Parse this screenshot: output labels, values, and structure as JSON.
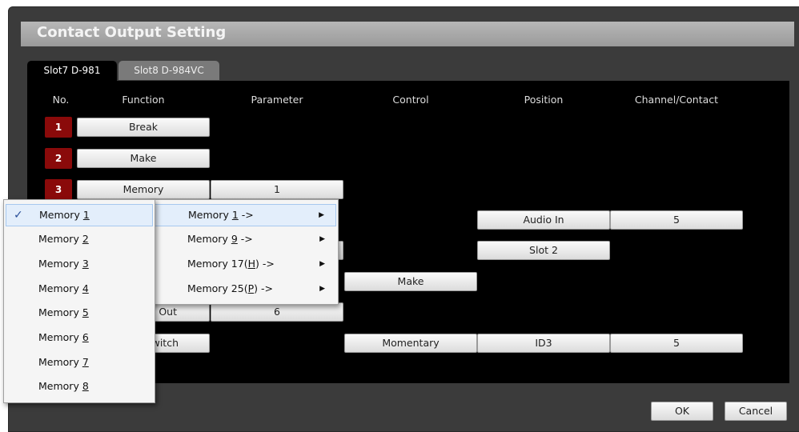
{
  "window": {
    "title": "Contact Output Setting"
  },
  "tabs": [
    {
      "label": "Slot7 D-981",
      "active": true
    },
    {
      "label": "Slot8 D-984VC",
      "active": false
    }
  ],
  "table": {
    "headers": [
      "No.",
      "Function",
      "Parameter",
      "Control",
      "Position",
      "Channel/Contact"
    ],
    "rows": [
      {
        "no": "1",
        "function": "Break"
      },
      {
        "no": "2",
        "function": "Make"
      },
      {
        "no": "3",
        "function": "Memory",
        "parameter": "1"
      },
      {
        "position": "Audio In",
        "channel": "5"
      },
      {
        "position": "Slot 2"
      },
      {
        "control": "Make"
      },
      {
        "function": "Out",
        "parameter": "6"
      },
      {
        "function": "witch",
        "control": "Momentary",
        "position": "ID3",
        "channel": "5"
      }
    ]
  },
  "memory_menu": {
    "items": [
      {
        "prefix": "Memory ",
        "key": "1",
        "checked": true
      },
      {
        "prefix": "Memory ",
        "key": "2"
      },
      {
        "prefix": "Memory ",
        "key": "3"
      },
      {
        "prefix": "Memory ",
        "key": "4"
      },
      {
        "prefix": "Memory ",
        "key": "5"
      },
      {
        "prefix": "Memory ",
        "key": "6"
      },
      {
        "prefix": "Memory ",
        "key": "7"
      },
      {
        "prefix": "Memory ",
        "key": "8"
      }
    ],
    "check_glyph": "✓"
  },
  "group_menu": {
    "items": [
      {
        "prefix": "Memory ",
        "key": "1",
        "suffix": " ->"
      },
      {
        "prefix": "Memory ",
        "key": "9",
        "suffix": " ->"
      },
      {
        "prefix": "Memory 17(",
        "key": "H",
        "suffix": ") ->"
      },
      {
        "prefix": "Memory 25(",
        "key": "P",
        "suffix": ") ->"
      }
    ],
    "arrow_glyph": "▶"
  },
  "footer": {
    "ok_label": "OK",
    "cancel_label": "Cancel"
  }
}
